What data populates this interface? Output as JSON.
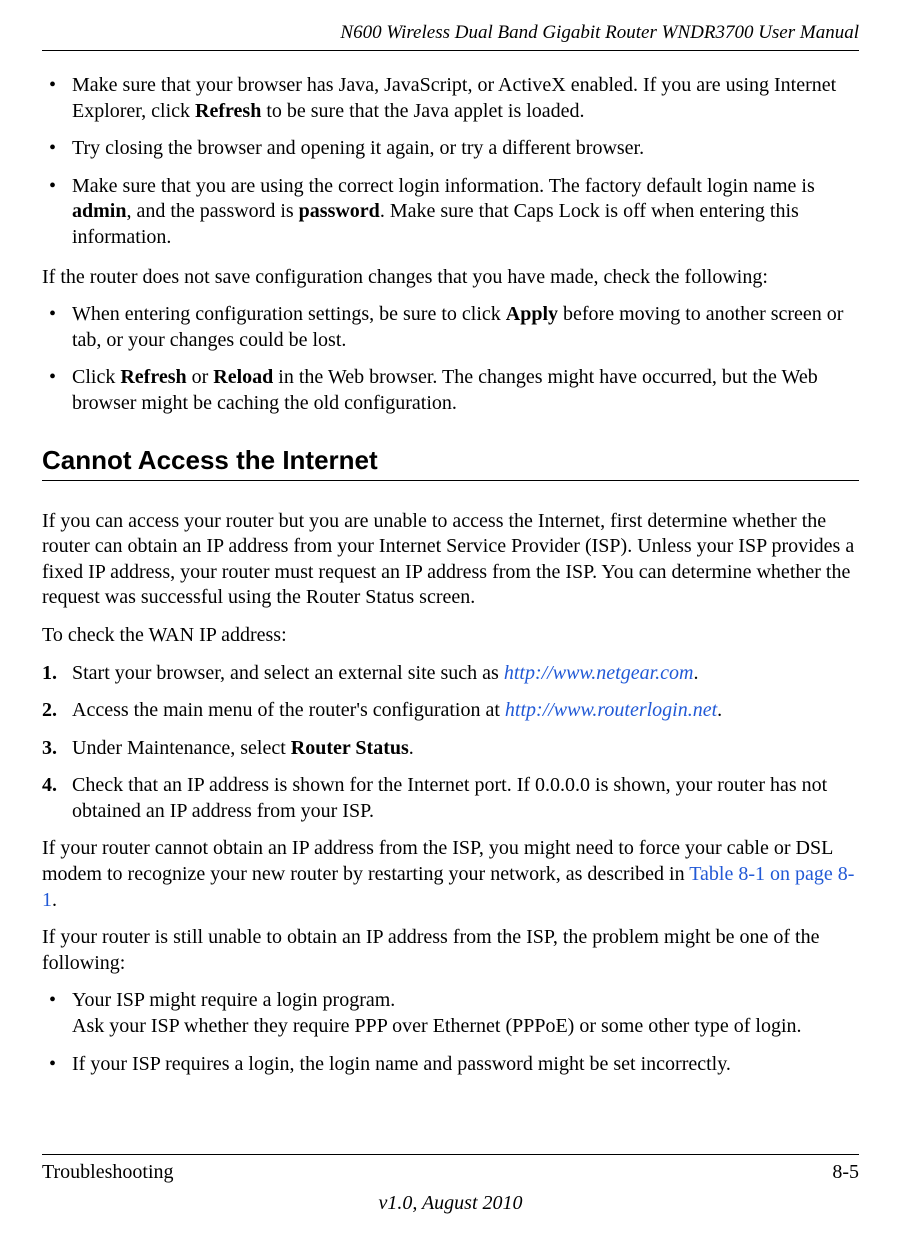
{
  "header": {
    "title": "N600 Wireless Dual Band Gigabit Router WNDR3700 User Manual"
  },
  "bullets1": [
    {
      "pre": "Make sure that your browser has Java, JavaScript, or ActiveX enabled. If you are using Internet Explorer, click ",
      "b1": "Refresh",
      "post": " to be sure that the Java applet is loaded."
    },
    {
      "pre": "Try closing the browser and opening it again, or try a different browser.",
      "b1": "",
      "post": ""
    },
    {
      "pre": "Make sure that you are using the correct login information. The factory default login name is ",
      "b1": "admin",
      "mid": ", and the password is ",
      "b2": "password",
      "post": ". Make sure that Caps Lock is off when entering this information."
    }
  ],
  "para1": "If the router does not save configuration changes that you have made, check the following:",
  "bullets2": [
    {
      "pre": "When entering configuration settings, be sure to click ",
      "b1": "Apply",
      "post": " before moving to another screen or tab, or your changes could be lost."
    },
    {
      "pre": "Click ",
      "b1": "Refresh",
      "mid": " or ",
      "b2": "Reload",
      "post": " in the Web browser. The changes might have occurred, but the Web browser might be caching the old configuration."
    }
  ],
  "section_heading": "Cannot Access the Internet",
  "para2": "If you can access your router but you are unable to access the Internet, first determine whether the router can obtain an IP address from your Internet Service Provider (ISP). Unless your ISP provides a fixed IP address, your router must request an IP address from the ISP. You can determine whether the request was successful using the Router Status screen.",
  "para3": "To check the WAN IP address:",
  "steps": [
    {
      "num": "1.",
      "pre": "Start your browser, and select an external site such as ",
      "link": "http://www.netgear.com",
      "post": "."
    },
    {
      "num": "2.",
      "pre": "Access the main menu of the router's configuration at ",
      "link": "http://www.routerlogin.net",
      "post": "."
    },
    {
      "num": "3.",
      "pre": "Under Maintenance, select ",
      "b1": "Router Status",
      "post": "."
    },
    {
      "num": "4.",
      "pre": "Check that an IP address is shown for the Internet port. If 0.0.0.0 is shown, your router has not obtained an IP address from your ISP.",
      "b1": "",
      "post": ""
    }
  ],
  "para4_pre": "If your router cannot obtain an IP address from the ISP, you might need to force your cable or DSL modem to recognize your new router by restarting your network, as described in ",
  "para4_xref": "Table 8-1 on page 8-1",
  "para4_post": ".",
  "para5": "If your router is still unable to obtain an IP address from the ISP, the problem might be one of the following:",
  "bullets3": [
    {
      "line1": "Your ISP might require a login program.",
      "line2": "Ask your ISP whether they require PPP over Ethernet (PPPoE) or some other type of login."
    },
    {
      "line1": "If your ISP requires a login, the login name and password might be set incorrectly.",
      "line2": ""
    }
  ],
  "footer": {
    "chapter": "Troubleshooting",
    "page": "8-5",
    "version": "v1.0, August 2010"
  }
}
